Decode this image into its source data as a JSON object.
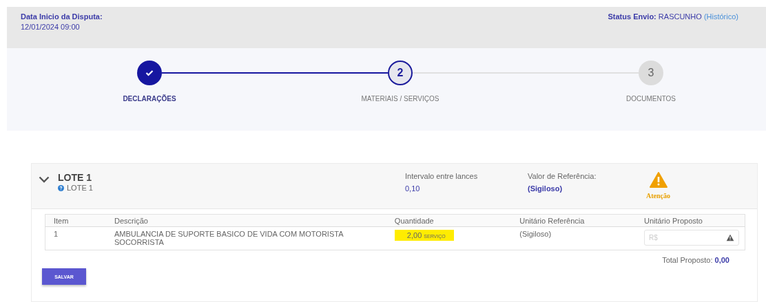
{
  "header": {
    "start_label": "Data Inicio da Disputa:",
    "start_value": "12/01/2024 09:00",
    "status_label": "Status Envio:",
    "status_value": "RASCUNHO",
    "history_link": "(Histórico)"
  },
  "steps": [
    {
      "label": "DECLARAÇÕES",
      "completed": true,
      "selected": false
    },
    {
      "number": "2",
      "label": "MATERIAIS / SERVIÇOS",
      "completed": false,
      "selected": true
    },
    {
      "number": "3",
      "label": "DOCUMENTOS",
      "completed": false,
      "selected": false
    }
  ],
  "lot": {
    "title": "LOTE 1",
    "subtitle": "LOTE 1",
    "expanded": true,
    "interval_label": "Intervalo entre lances",
    "interval_value": "0,10",
    "reference_label": "Valor de Referência:",
    "reference_value": "(Sigiloso)",
    "warning_label": "Atenção",
    "table": {
      "columns": [
        "Item",
        "Descrição",
        "Quantidade",
        "Unitário Referência",
        "Unitário Proposto"
      ],
      "rows": [
        {
          "item": "1",
          "description": "AMBULANCIA DE SUPORTE BASICO DE VIDA COM MOTORISTA SOCORRISTA",
          "quantity": "2,00",
          "unit": "SERVIÇO",
          "quantity_highlighted": true,
          "reference": "(Sigiloso)",
          "proposed_placeholder": "R$"
        }
      ]
    },
    "total_label": "Total Proposto:",
    "total_value": "0,00",
    "save_button": "SALVAR"
  }
}
